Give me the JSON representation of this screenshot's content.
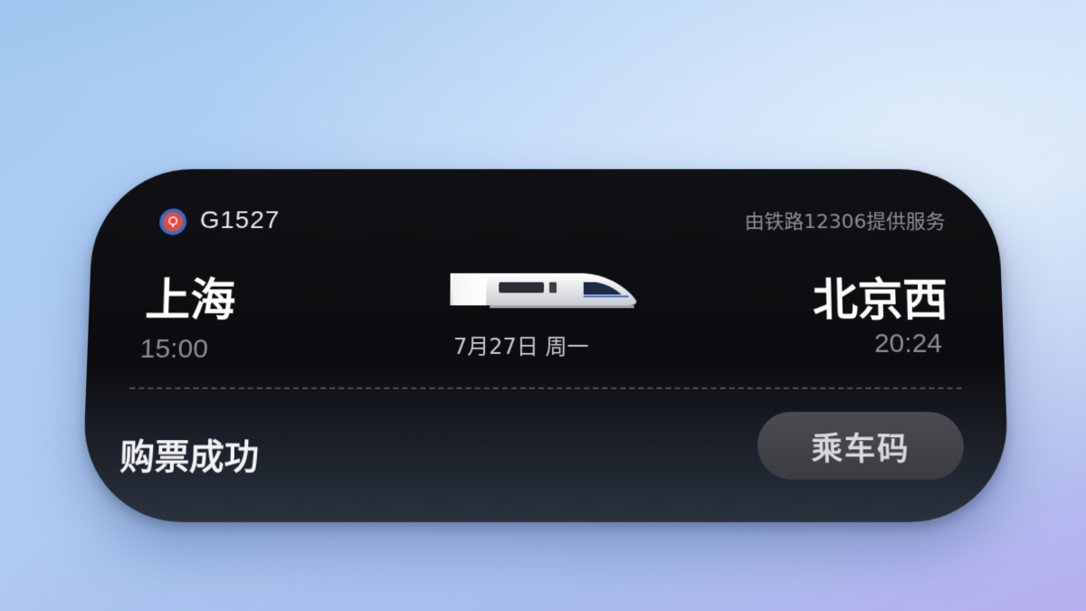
{
  "ticket": {
    "train_number": "G1527",
    "provider_text": "由铁路12306提供服务",
    "from_station": "上海",
    "from_time": "15:00",
    "to_station": "北京西",
    "to_time": "20:24",
    "date": "7月27日 周一",
    "status": "购票成功",
    "ride_code_button": "乘车码"
  },
  "icons": {
    "logo": "china-railway-logo-icon",
    "train": "high-speed-train-icon"
  },
  "colors": {
    "card_bg": "#0b0c0f",
    "logo_blue": "#2f6fc8",
    "logo_red": "#e84a3c",
    "button_bg": "#3a3c42"
  }
}
